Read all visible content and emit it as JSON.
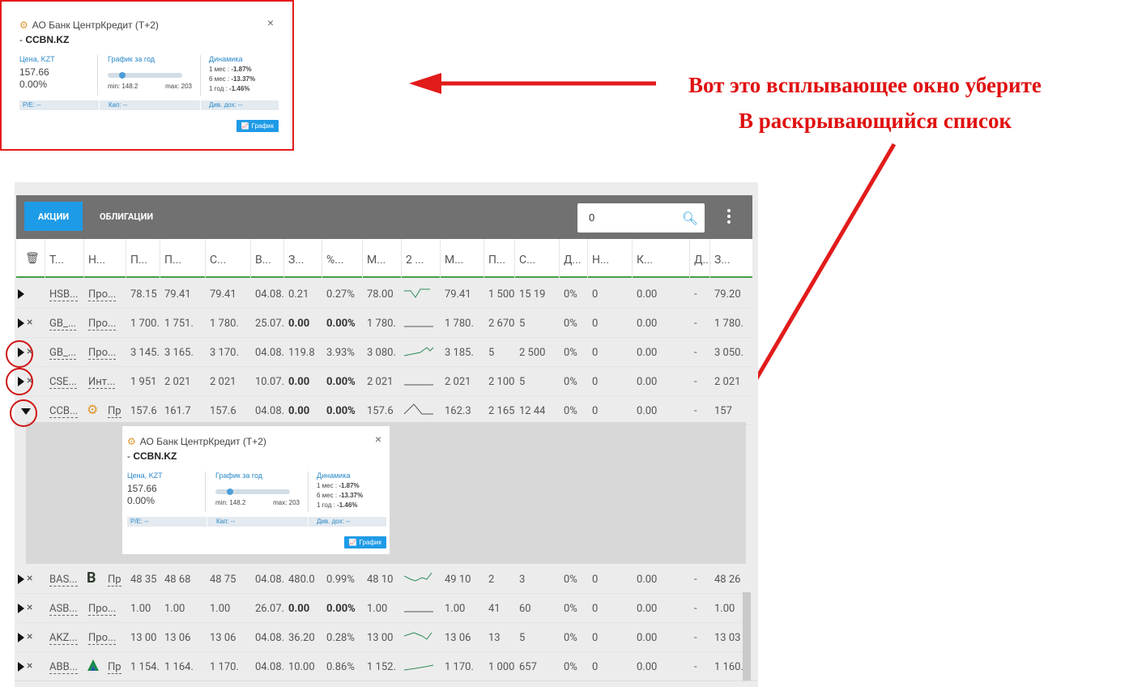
{
  "popup": {
    "title": "АО Банк ЦентрКредит (T+2)",
    "ticker_prefix": "-",
    "ticker": "CCBN.KZ",
    "close": "×",
    "price_label": "Цена, KZT",
    "price": "157.66",
    "change": "0.00%",
    "year_chart_label": "График за год",
    "min": "min: 148.2",
    "max": "max: 203",
    "dynamics_label": "Динамика",
    "dyn_1m_label": "1 мес :",
    "dyn_1m": "-1.87%",
    "dyn_6m_label": "6 мес :",
    "dyn_6m": "-13.37%",
    "dyn_1y_label": "1 год :",
    "dyn_1y": "-1.46%",
    "pe": "P/E: --",
    "cap": "Кап: --",
    "div": "Див. дох: --",
    "chart_button": "График",
    "slider_position": 0.17
  },
  "annotation": {
    "line1": "Вот это всплывающее окно уберите",
    "line2": "В раскрывающийся список",
    "color": "#e01010"
  },
  "toolbar": {
    "tab_shares": "АКЦИИ",
    "tab_bonds": "ОБЛИГАЦИИ",
    "search_value": "0",
    "accent": "#1e9be6"
  },
  "headers": [
    "Т...",
    "Н...",
    "П...",
    "П...",
    "С...",
    "В...",
    "З...",
    "%...",
    "М...",
    "2 ...",
    "М...",
    "П...",
    "С...",
    "Д...",
    "Н...",
    "К...",
    "Д...",
    "З..."
  ],
  "rows": [
    {
      "ticker": "HSB...",
      "name": "Про...",
      "c": [
        "78.15",
        "79.41",
        "79.41",
        "04.08.",
        "0.21",
        "0.27%",
        "78.00",
        "",
        "79.41",
        "1 500",
        "15 19",
        "0%",
        "0",
        "0.00",
        "-",
        "79.20"
      ],
      "x": false,
      "spark": "up"
    },
    {
      "ticker": "GB_...",
      "name": "Про...",
      "c": [
        "1 700.",
        "1 751.",
        "1 780.",
        "25.07.",
        "0.00",
        "0.00%",
        "1 780.",
        "",
        "1 780.",
        "2 670",
        "5",
        "0%",
        "0",
        "0.00",
        "-",
        "1 780."
      ],
      "x": true,
      "spark": "flat"
    },
    {
      "ticker": "GB_...",
      "name": "Про...",
      "c": [
        "3 145.",
        "3 165.",
        "3 170.",
        "04.08.",
        "119.8",
        "3.93%",
        "3 080.",
        "",
        "3 185.",
        "5",
        "2 500",
        "0%",
        "0",
        "0.00",
        "-",
        "3 050."
      ],
      "x": true,
      "spark": "up2"
    },
    {
      "ticker": "CSE...",
      "name": "Инт...",
      "c": [
        "1 951",
        "2 021",
        "2 021",
        "10.07.",
        "0.00",
        "0.00%",
        "2 021",
        "",
        "2 021",
        "2 100",
        "5",
        "0%",
        "0",
        "0.00",
        "-",
        "2 021"
      ],
      "x": true,
      "spark": "flat"
    },
    {
      "ticker": "CCB...",
      "name": "Пр",
      "c": [
        "157.6",
        "161.7",
        "157.6",
        "04.08.",
        "0.00",
        "0.00%",
        "157.6",
        "",
        "162.3",
        "2 165",
        "12 44",
        "0%",
        "0",
        "0.00",
        "-",
        "157"
      ],
      "x": false,
      "spark": "peak"
    },
    {
      "ticker": "BAS...",
      "name": "Пр",
      "c": [
        "48 35",
        "48 68",
        "48 75",
        "04.08.",
        "480.0",
        "0.99%",
        "48 10",
        "",
        "49 10",
        "2",
        "3",
        "0%",
        "0",
        "0.00",
        "-",
        "48 26"
      ],
      "x": true,
      "spark": "wave"
    },
    {
      "ticker": "ASB...",
      "name": "Про...",
      "c": [
        "1.00",
        "1.00",
        "1.00",
        "26.07.",
        "0.00",
        "0.00%",
        "1.00",
        "",
        "1.00",
        "41",
        "60",
        "0%",
        "0",
        "0.00",
        "-",
        "1.00"
      ],
      "x": true,
      "spark": "flat"
    },
    {
      "ticker": "AKZ...",
      "name": "Про...",
      "c": [
        "13 00",
        "13 06",
        "13 06",
        "04.08.",
        "36.20",
        "0.28%",
        "13 00",
        "",
        "13 06",
        "13",
        "5",
        "0%",
        "0",
        "0.00",
        "-",
        "13 03"
      ],
      "x": true,
      "spark": "hump"
    },
    {
      "ticker": "ABB...",
      "name": "Пр",
      "c": [
        "1 154.",
        "1 164.",
        "1 170.",
        "04.08.",
        "10.00",
        "0.86%",
        "1 152.",
        "",
        "1 170.",
        "1 000",
        "657",
        "0%",
        "0",
        "0.00",
        "-",
        "1 160."
      ],
      "x": true,
      "spark": "rise"
    }
  ]
}
